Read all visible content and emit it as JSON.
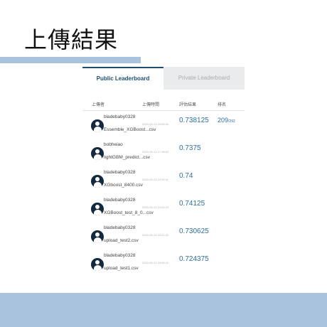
{
  "page": {
    "title": "上傳結果"
  },
  "tabs": [
    {
      "label": "Public Leaderboard",
      "active": true
    },
    {
      "label": "Private Leaderboard",
      "active": false
    }
  ],
  "columns": {
    "uploader": "上傳者",
    "time": "上傳時間",
    "score": "評估結果",
    "rank": "排名"
  },
  "rows": [
    {
      "user": "bladebaby0328",
      "file": "Essemble_XGBoost...csv",
      "time": "2020-06-13 23:08:34",
      "score": "0.738125",
      "rank": "209",
      "rank_total": "/292"
    },
    {
      "user": "bobheiao",
      "file": "lightGBM_predict...csv",
      "time": "2020-06-13 17:38:53",
      "score": "0.7375",
      "rank": "",
      "rank_total": ""
    },
    {
      "user": "bladebaby0328",
      "file": "XGboost_8400.csv",
      "time": "2020-06-13 14:34:11",
      "score": "0.74",
      "rank": "",
      "rank_total": ""
    },
    {
      "user": "bladebaby0328",
      "file": "XGBoost_test_8_0...csv",
      "time": "2020-06-13 13:09:23",
      "score": "0.74125",
      "rank": "",
      "rank_total": ""
    },
    {
      "user": "bladebaby0328",
      "file": "upload_test2.csv",
      "time": "2020-06-12 23:51:43",
      "score": "0.730625",
      "rank": "",
      "rank_total": ""
    },
    {
      "user": "bladebaby0328",
      "file": "upload_test1.csv",
      "time": "2020-06-12 23:48:10",
      "score": "0.724375",
      "rank": "",
      "rank_total": ""
    }
  ],
  "colors": {
    "accent": "#1d4f70",
    "score": "#2c6e99",
    "band": "#a9c3dd",
    "avatar": "#13293d",
    "inactive_tab": "#e9ebec"
  },
  "icons": {
    "avatar": "user-avatar-icon"
  }
}
